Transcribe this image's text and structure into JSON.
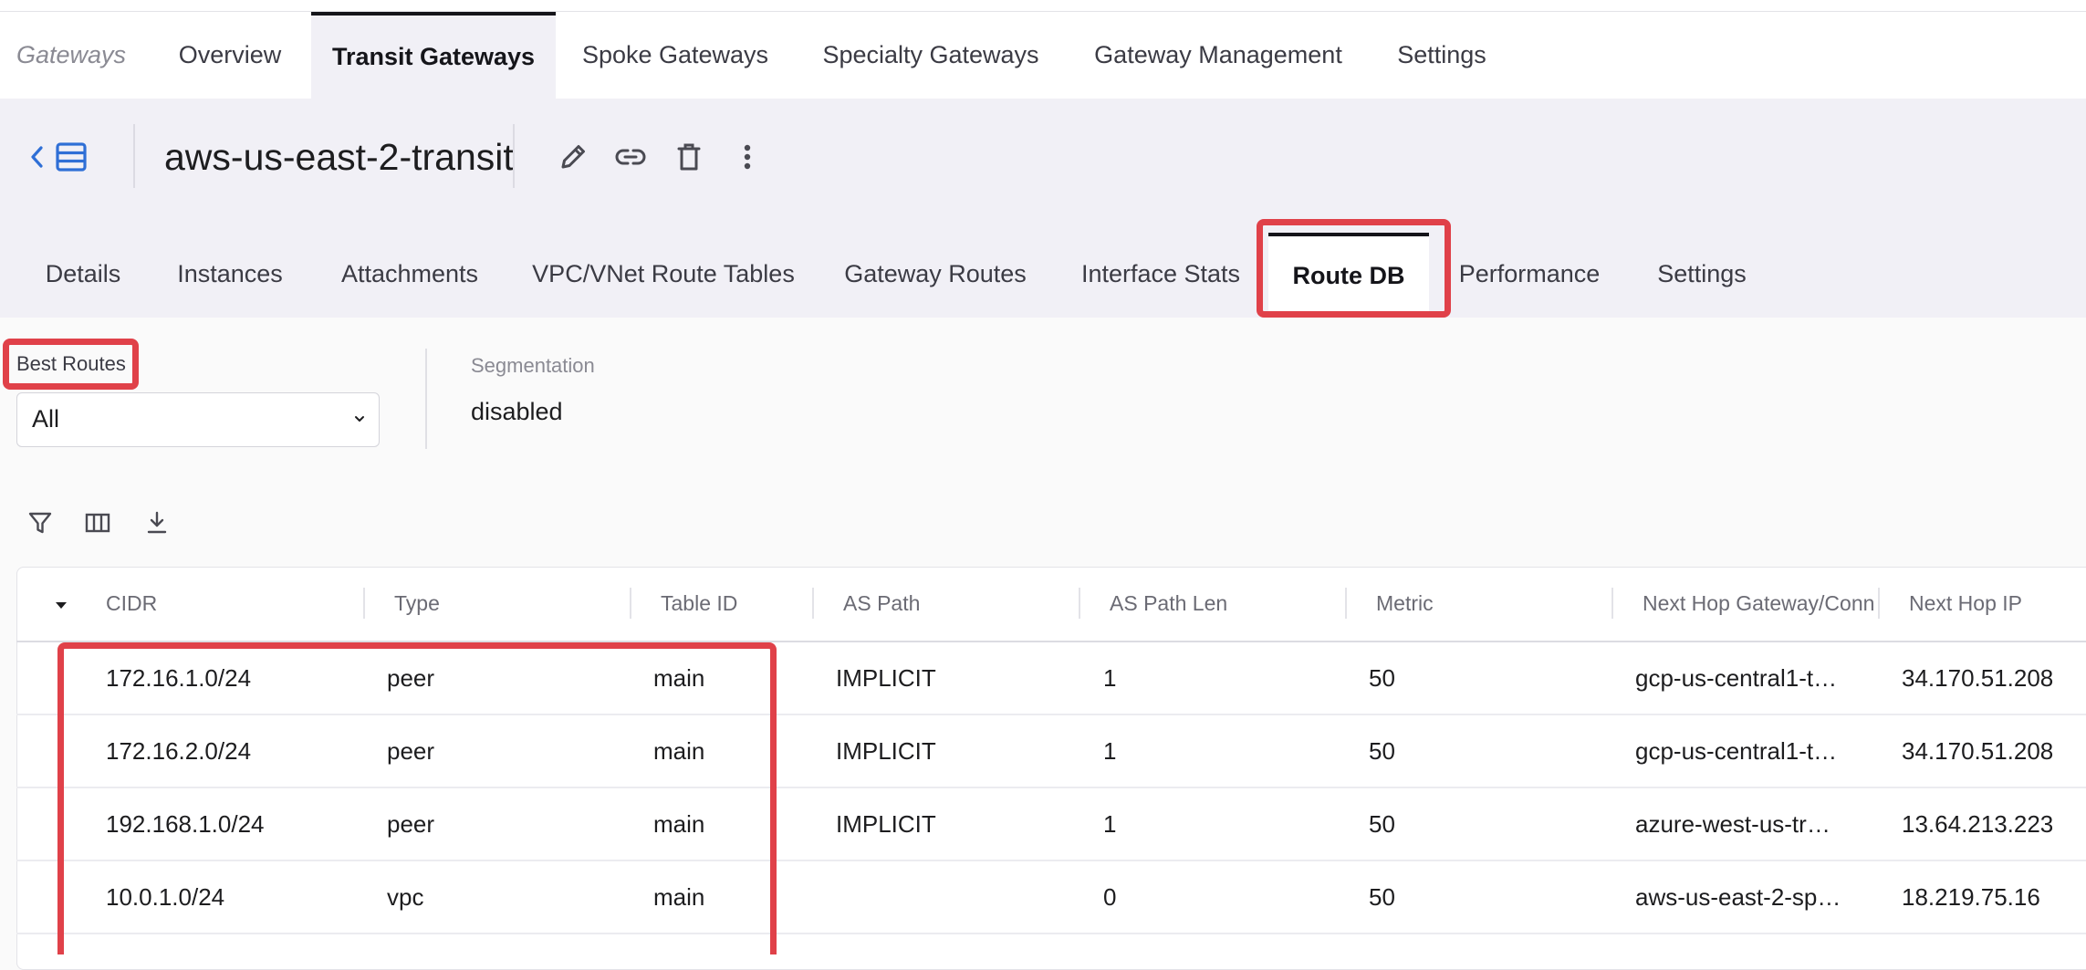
{
  "top_nav": {
    "section_label": "Gateways",
    "tabs": [
      "Overview",
      "Transit Gateways",
      "Spoke Gateways",
      "Specialty Gateways",
      "Gateway Management",
      "Settings"
    ],
    "active_tab": "Transit Gateways"
  },
  "header": {
    "gateway_name": "aws-us-east-2-transit",
    "icons": [
      "chevron-left-icon",
      "list-view-icon",
      "edit-pencil-icon",
      "link-icon",
      "trash-icon",
      "more-vertical-icon"
    ]
  },
  "sub_tabs": {
    "items": [
      "Details",
      "Instances",
      "Attachments",
      "VPC/VNet Route Tables",
      "Gateway Routes",
      "Interface Stats",
      "Route DB",
      "Performance",
      "Settings"
    ],
    "active": "Route DB"
  },
  "filters": {
    "best_routes_label": "Best Routes",
    "best_routes_value": "All",
    "segmentation_label": "Segmentation",
    "segmentation_value": "disabled"
  },
  "toolbar": {
    "icons": [
      "filter-icon",
      "columns-icon",
      "download-icon"
    ]
  },
  "table": {
    "columns": [
      "CIDR",
      "Type",
      "Table ID",
      "AS Path",
      "AS Path Len",
      "Metric",
      "Next Hop Gateway/Conne",
      "Next Hop IP"
    ],
    "rows": [
      [
        "172.16.1.0/24",
        "peer",
        "main",
        "IMPLICIT",
        "1",
        "50",
        "gcp-us-central1-t…",
        "34.170.51.208"
      ],
      [
        "172.16.2.0/24",
        "peer",
        "main",
        "IMPLICIT",
        "1",
        "50",
        "gcp-us-central1-t…",
        "34.170.51.208"
      ],
      [
        "192.168.1.0/24",
        "peer",
        "main",
        "IMPLICIT",
        "1",
        "50",
        "azure-west-us-tr…",
        "13.64.213.223"
      ],
      [
        "10.0.1.0/24",
        "vpc",
        "main",
        "",
        "0",
        "50",
        "aws-us-east-2-sp…",
        "18.219.75.16"
      ]
    ]
  },
  "colors": {
    "accent_blue": "#2f6fd6",
    "highlight_red": "#e04149",
    "header_band": "#f1f0f6"
  }
}
